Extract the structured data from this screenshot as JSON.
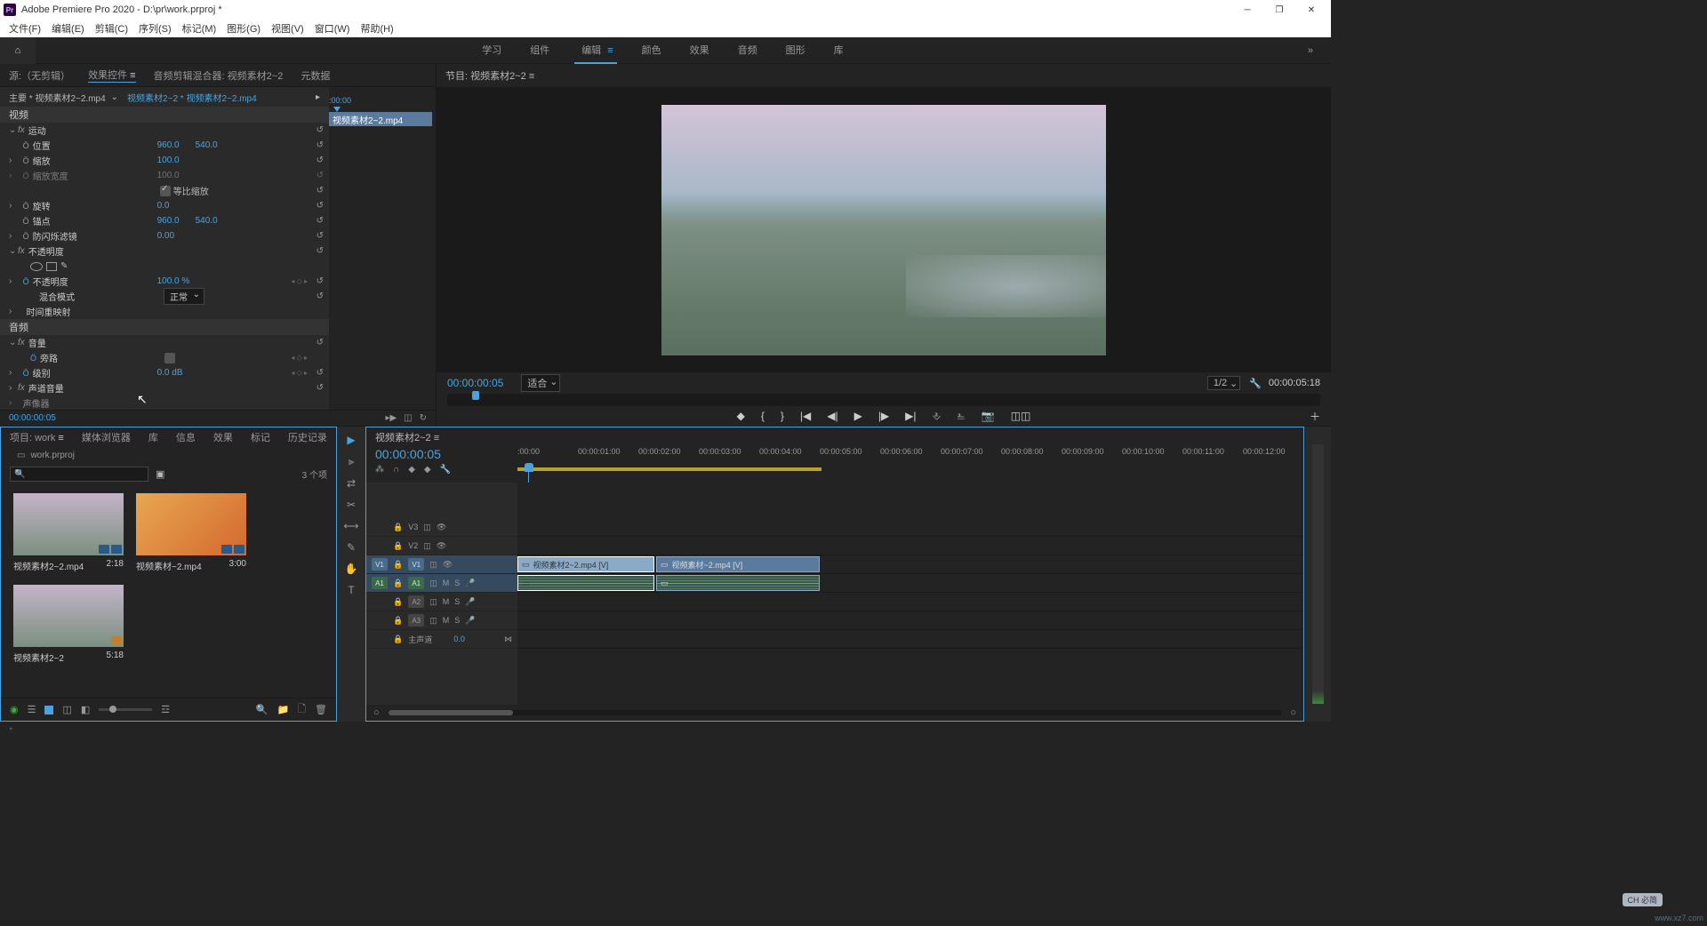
{
  "title": "Adobe Premiere Pro 2020 - D:\\pr\\work.prproj *",
  "menu": [
    "文件(F)",
    "编辑(E)",
    "剪辑(C)",
    "序列(S)",
    "标记(M)",
    "图形(G)",
    "视图(V)",
    "窗口(W)",
    "帮助(H)"
  ],
  "workspaces": [
    "学习",
    "组件",
    "编辑",
    "颜色",
    "效果",
    "音频",
    "图形",
    "库"
  ],
  "active_workspace": "编辑",
  "source_tabs": {
    "source": "源:（无剪辑）",
    "effect": "效果控件",
    "mixer": "音频剪辑混合器: 视频素材2~2",
    "meta": "元数据"
  },
  "effect_header": {
    "main": "主要 * 视频素材2~2.mp4",
    "path": "视频素材2~2 * 视频素材2~2.mp4"
  },
  "effect_timeline_clip": "视频素材2~2.mp4",
  "effect_timeline_start": ":00:00",
  "effects": {
    "video": "视频",
    "motion": "运动",
    "position": {
      "label": "位置",
      "x": "960.0",
      "y": "540.0"
    },
    "scale": {
      "label": "缩放",
      "v": "100.0"
    },
    "scale_w": {
      "label": "缩放宽度",
      "v": "100.0"
    },
    "uniform": "等比缩放",
    "rotation": {
      "label": "旋转",
      "v": "0.0"
    },
    "anchor": {
      "label": "锚点",
      "x": "960.0",
      "y": "540.0"
    },
    "antiflicker": {
      "label": "防闪烁滤镜",
      "v": "0.00"
    },
    "opacity_fx": "不透明度",
    "opacity": {
      "label": "不透明度",
      "v": "100.0 %"
    },
    "blend": {
      "label": "混合模式",
      "v": "正常"
    },
    "timeremap": "时间重映射",
    "audio": "音频",
    "volume_fx": "音量",
    "bypass": "旁路",
    "level": {
      "label": "级别",
      "v": "0.0 dB"
    },
    "channel_vol": "声道音量",
    "panner": "声像器"
  },
  "effect_footer_tc": "00:00:00:05",
  "program_title": "节目: 视频素材2~2",
  "program_tc": "00:00:00:05",
  "program_fit": "适合",
  "program_res": "1/2",
  "program_dur": "00:00:05:18",
  "project_tabs": [
    "项目: work",
    "媒体浏览器",
    "库",
    "信息",
    "效果",
    "标记",
    "历史记录"
  ],
  "project_file": "work.prproj",
  "project_count": "3 个项",
  "project_items": [
    {
      "name": "视频素材2~2.mp4",
      "dur": "2:18",
      "thumb": "city"
    },
    {
      "name": "视频素材~2.mp4",
      "dur": "3:00",
      "thumb": "orange"
    },
    {
      "name": "视频素材2~2",
      "dur": "5:18",
      "thumb": "city"
    }
  ],
  "timeline_title": "视频素材2~2",
  "timeline_tc": "00:00:00:05",
  "ruler": [
    ":00:00",
    "00:00:01:00",
    "00:00:02:00",
    "00:00:03:00",
    "00:00:04:00",
    "00:00:05:00",
    "00:00:06:00",
    "00:00:07:00",
    "00:00:08:00",
    "00:00:09:00",
    "00:00:10:00",
    "00:00:11:00",
    "00:00:12:00"
  ],
  "tracks": {
    "v3": "V3",
    "v2": "V2",
    "v1": "V1",
    "a1": "A1",
    "a2": "A2",
    "a3": "A3",
    "master": "主声道",
    "master_val": "0.0",
    "m": "M",
    "s": "S"
  },
  "clips": {
    "v1a": "视频素材2~2.mp4 [V]",
    "v1b": "视频素材~2.mp4 [V]"
  },
  "ime": "CH 必简",
  "watermark": "www.xz7.com"
}
